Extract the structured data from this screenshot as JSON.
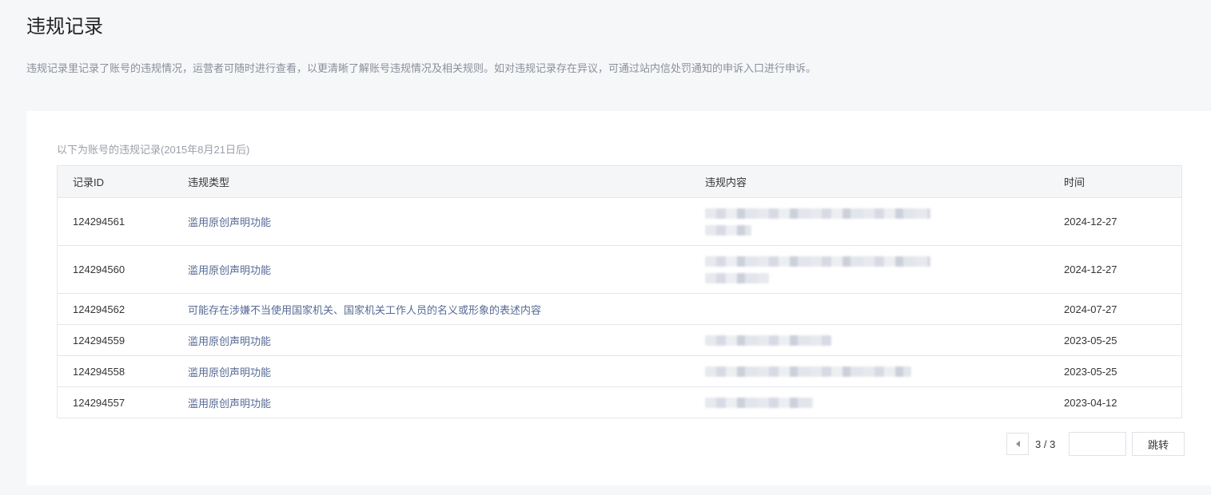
{
  "header": {
    "title": "违规记录",
    "description": "违规记录里记录了账号的违规情况，运营者可随时进行查看，以更清晰了解账号违规情况及相关规则。如对违规记录存在异议，可通过站内信处罚通知的申诉入口进行申诉。"
  },
  "table": {
    "caption": "以下为账号的违规记录(2015年8月21日后)",
    "columns": {
      "id": "记录ID",
      "type": "违规类型",
      "content": "违规内容",
      "time": "时间"
    },
    "rows": [
      {
        "id": "124294561",
        "type": "滥用原创声明功能",
        "time": "2024-12-27"
      },
      {
        "id": "124294560",
        "type": "滥用原创声明功能",
        "time": "2024-12-27"
      },
      {
        "id": "124294562",
        "type": "可能存在涉嫌不当使用国家机关、国家机关工作人员的名义或形象的表述内容",
        "time": "2024-07-27"
      },
      {
        "id": "124294559",
        "type": "滥用原创声明功能",
        "time": "2023-05-25"
      },
      {
        "id": "124294558",
        "type": "滥用原创声明功能",
        "time": "2023-05-25"
      },
      {
        "id": "124294557",
        "type": "滥用原创声明功能",
        "time": "2023-04-12"
      }
    ]
  },
  "pager": {
    "current": "3 / 3",
    "input_value": "",
    "go_label": "跳转"
  },
  "icons": {
    "prev": "caret-left-icon"
  }
}
